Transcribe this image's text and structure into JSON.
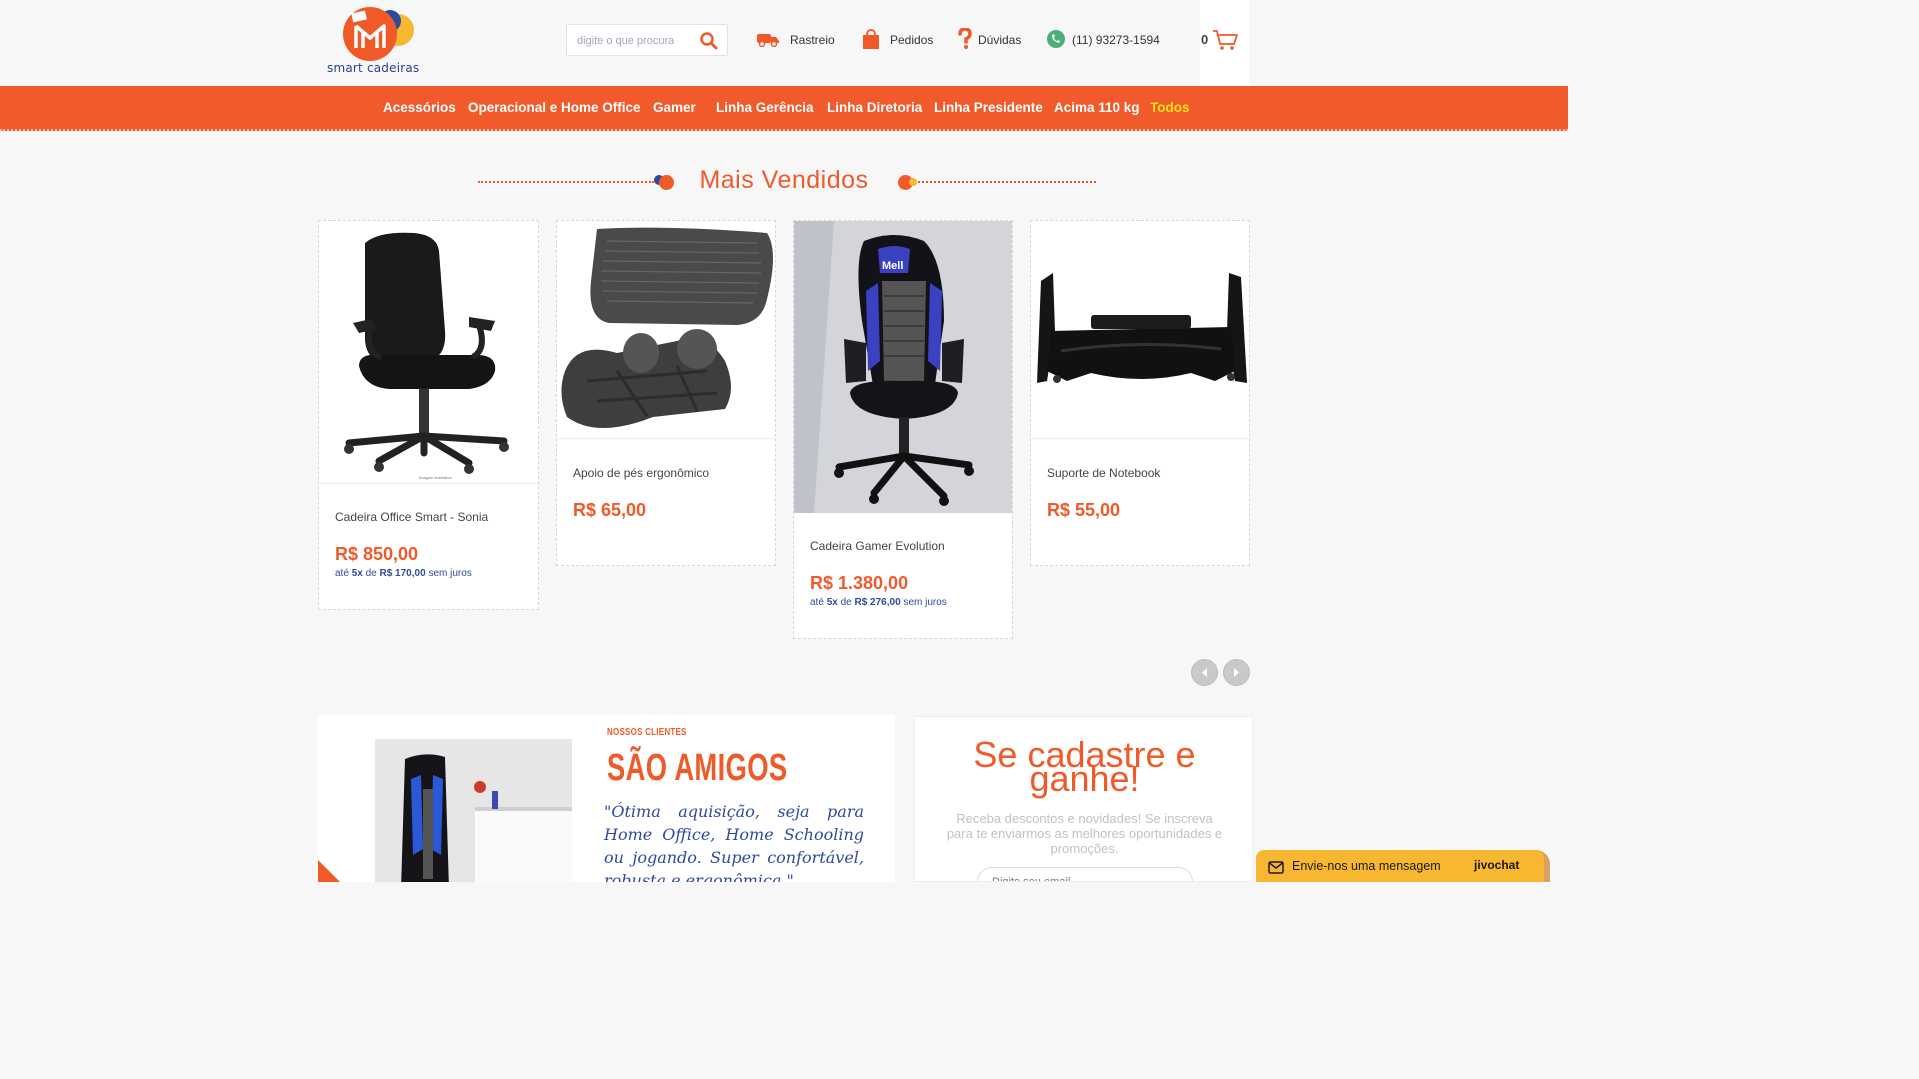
{
  "brand": {
    "name": "smart cadeiras"
  },
  "search": {
    "placeholder": "digite o que procura"
  },
  "header_links": {
    "tracking": "Rastreio",
    "orders": "Pedidos",
    "help": "Dúvidas",
    "phone": "(11) 93273-1594"
  },
  "cart": {
    "count": "0"
  },
  "nav": {
    "items": [
      "Acessórios",
      "Operacional e Home Office",
      "Gamer",
      "Linha Gerência",
      "Linha Diretoria",
      "Linha Presidente",
      "Acima 110 kg",
      "Todos"
    ]
  },
  "bestsellers": {
    "title": "Mais Vendidos",
    "products": [
      {
        "name": "Cadeira Office Smart - Sonia",
        "price": "R$ 850,00",
        "inst_prefix": "até",
        "inst_count": "5x",
        "inst_mid": "de",
        "inst_value": "R$ 170,00",
        "inst_suffix": "sem juros",
        "img_caption": "Imagem ilustrativa"
      },
      {
        "name": "Apoio de pés ergonômico",
        "price": "R$ 65,00"
      },
      {
        "name": "Cadeira Gamer Evolution",
        "price": "R$ 1.380,00",
        "inst_prefix": "até",
        "inst_count": "5x",
        "inst_mid": "de",
        "inst_value": "R$ 276,00",
        "inst_suffix": "sem juros",
        "img_caption": "Mell"
      },
      {
        "name": "Suporte de Notebook",
        "price": "R$ 55,00"
      }
    ]
  },
  "testimonial": {
    "kicker": "NOSSOS CLIENTES",
    "headline": "SÃO AMIGOS",
    "quote": "\"Ótima aquisição, seja para Home Office, Home Schooling ou jogando. Super confortável, robusta e ergonômica.\""
  },
  "signup": {
    "title": "Se cadastre e ganhe!",
    "text": "Receba descontos e novidades! Se inscreva para te enviarmos as melhores oportunidades e promoções.",
    "email_placeholder": "Digite seu email"
  },
  "chat": {
    "label": "Envie-nos uma mensagem",
    "brand": "jivochat"
  },
  "colors": {
    "primary": "#f05a28",
    "blue": "#2e4a9e",
    "yellow": "#ffe21a",
    "chat": "#f7b731"
  }
}
